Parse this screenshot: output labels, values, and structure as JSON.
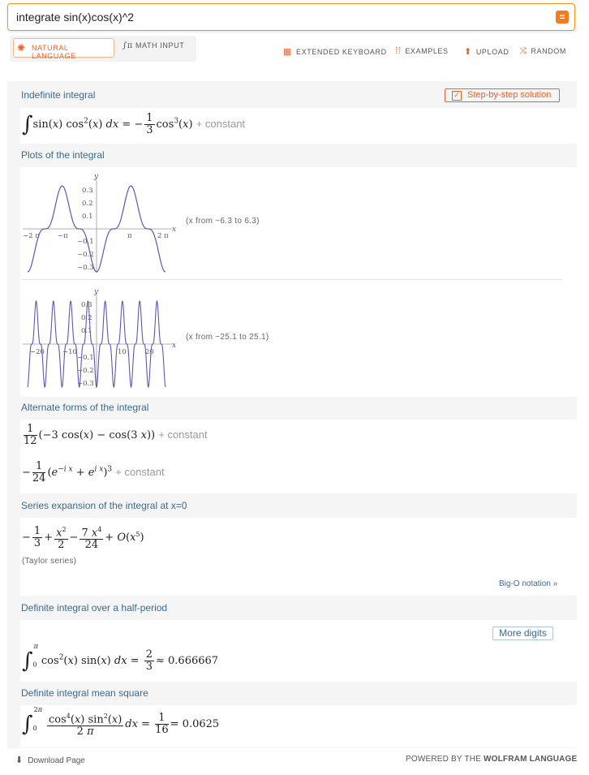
{
  "search": {
    "query": "integrate sin(x)cos(x)^2"
  },
  "modes": {
    "natural_language": "NATURAL LANGUAGE",
    "math_input": "MATH INPUT"
  },
  "tools": {
    "extended_keyboard": "EXTENDED KEYBOARD",
    "examples": "EXAMPLES",
    "upload": "UPLOAD",
    "random": "RANDOM"
  },
  "pods": {
    "indefinite": {
      "title": "Indefinite integral",
      "step_button": "Step-by-step solution",
      "constant": "+ constant"
    },
    "plots": {
      "title": "Plots of the integral",
      "plot1": {
        "range_label": "(x from −6.3 to 6.3)",
        "y_ticks": [
          "0.3",
          "0.2",
          "0.1",
          "−0.1",
          "−0.2",
          "−0.3"
        ],
        "x_ticks": [
          "−2 π",
          "−π",
          "π",
          "2 π"
        ],
        "xlabel": "x",
        "ylabel": "y"
      },
      "plot2": {
        "range_label": "(x from −25.1 to 25.1)",
        "y_ticks": [
          "0.3",
          "0.2",
          "0.1",
          "−0.1",
          "−0.2",
          "−0.3"
        ],
        "x_ticks": [
          "−20",
          "−10",
          "10",
          "20"
        ],
        "xlabel": "x",
        "ylabel": "y"
      }
    },
    "alternate": {
      "title": "Alternate forms of the integral",
      "constant": "+ constant"
    },
    "series": {
      "title": "Series expansion of the integral at x=0",
      "note": "(Taylor series)",
      "link": "Big-O notation »"
    },
    "definite": {
      "title": "Definite integral over a half-period",
      "button": "More digits",
      "value": "0.666667"
    },
    "mean_square": {
      "title": "Definite integral mean square",
      "value": "0.0625"
    }
  },
  "footer": {
    "download": "Download Page",
    "powered_by": "POWERED BY THE",
    "wolfram": "WOLFRAM LANGUAGE"
  },
  "chart_data": [
    {
      "type": "line",
      "function": "-(1/3)cos^3(x)",
      "xlim": [
        -6.3,
        6.3
      ],
      "ylim": [
        -0.34,
        0.34
      ],
      "xlabel": "x",
      "ylabel": "y",
      "series": [
        {
          "name": "",
          "color": "#5d56b5"
        }
      ]
    },
    {
      "type": "line",
      "function": "-(1/3)cos^3(x)",
      "xlim": [
        -25.1,
        25.1
      ],
      "ylim": [
        -0.34,
        0.34
      ],
      "xlabel": "x",
      "ylabel": "y",
      "series": [
        {
          "name": "",
          "color": "#5d56b5"
        }
      ]
    }
  ]
}
